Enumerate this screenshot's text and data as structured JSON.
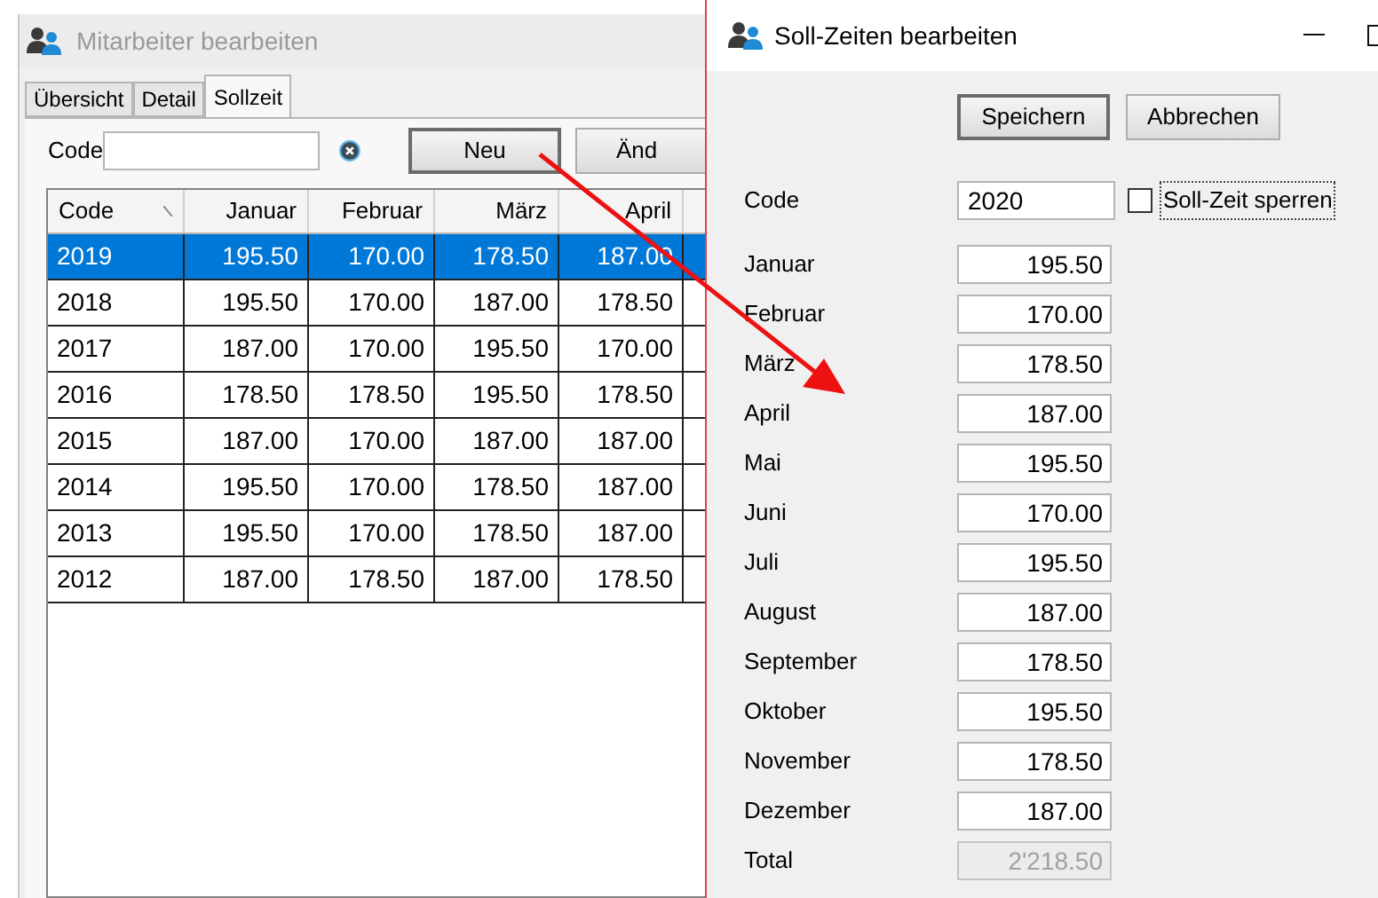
{
  "main_window": {
    "title": "Mitarbeiter bearbeiten",
    "tabs": [
      {
        "label": "Übersicht",
        "selected": false
      },
      {
        "label": "Detail",
        "selected": false
      },
      {
        "label": "Sollzeit",
        "selected": true
      }
    ],
    "code_label": "Code",
    "buttons": [
      {
        "label": "Neu",
        "default": true
      },
      {
        "label": "Änd",
        "default": false
      }
    ],
    "table": {
      "columns": [
        "Code",
        "Januar",
        "Februar",
        "März",
        "April"
      ],
      "rows": [
        {
          "cells": [
            "2019",
            "195.50",
            "170.00",
            "178.50",
            "187.00"
          ],
          "selected": true
        },
        {
          "cells": [
            "2018",
            "195.50",
            "170.00",
            "187.00",
            "178.50"
          ],
          "selected": false
        },
        {
          "cells": [
            "2017",
            "187.00",
            "170.00",
            "195.50",
            "170.00"
          ],
          "selected": false
        },
        {
          "cells": [
            "2016",
            "178.50",
            "178.50",
            "195.50",
            "178.50"
          ],
          "selected": false
        },
        {
          "cells": [
            "2015",
            "187.00",
            "170.00",
            "187.00",
            "187.00"
          ],
          "selected": false
        },
        {
          "cells": [
            "2014",
            "195.50",
            "170.00",
            "178.50",
            "187.00"
          ],
          "selected": false
        },
        {
          "cells": [
            "2013",
            "195.50",
            "170.00",
            "178.50",
            "187.00"
          ],
          "selected": false
        },
        {
          "cells": [
            "2012",
            "187.00",
            "178.50",
            "187.00",
            "178.50"
          ],
          "selected": false
        }
      ]
    }
  },
  "dialog": {
    "title": "Soll-Zeiten bearbeiten",
    "buttons": [
      {
        "label": "Speichern",
        "default": true
      },
      {
        "label": "Abbrechen",
        "default": false
      }
    ],
    "code_label": "Code",
    "code_value": "2020",
    "lock_checkbox": {
      "label": "Soll-Zeit sperren",
      "checked": false
    },
    "months": [
      {
        "label": "Januar",
        "value": "195.50"
      },
      {
        "label": "Februar",
        "value": "170.00"
      },
      {
        "label": "März",
        "value": "178.50"
      },
      {
        "label": "April",
        "value": "187.00"
      },
      {
        "label": "Mai",
        "value": "195.50"
      },
      {
        "label": "Juni",
        "value": "170.00"
      },
      {
        "label": "Juli",
        "value": "195.50"
      },
      {
        "label": "August",
        "value": "187.00"
      },
      {
        "label": "September",
        "value": "178.50"
      },
      {
        "label": "Oktober",
        "value": "195.50"
      },
      {
        "label": "November",
        "value": "178.50"
      },
      {
        "label": "Dezember",
        "value": "187.00"
      }
    ],
    "total": {
      "label": "Total",
      "value": "2'218.50",
      "disabled": true
    }
  }
}
